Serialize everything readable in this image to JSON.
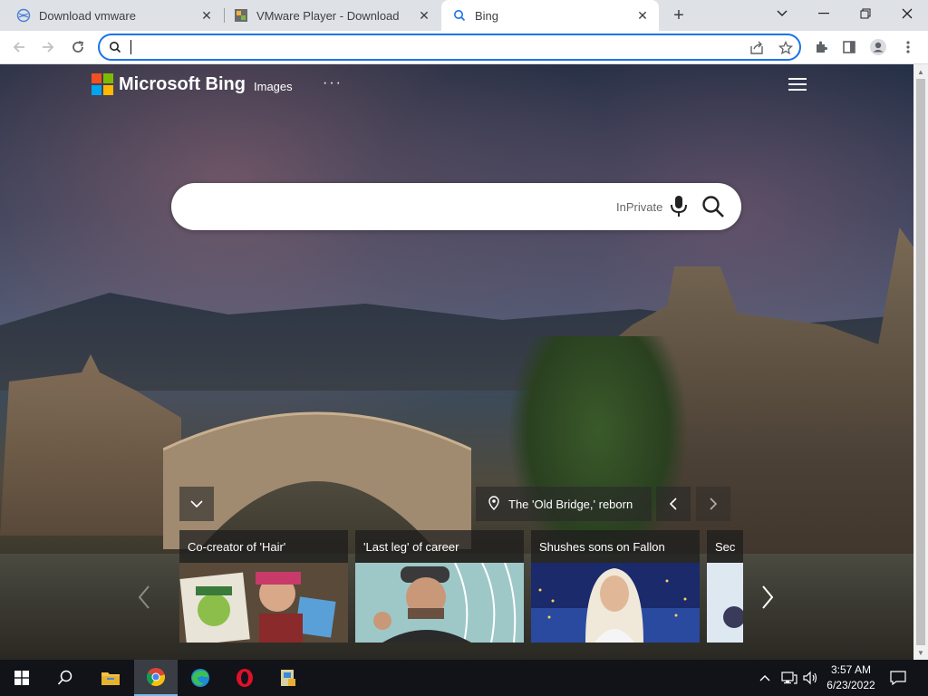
{
  "browser": {
    "tabs": [
      {
        "title": "Download vmware",
        "active": false
      },
      {
        "title": "VMware Player - Download",
        "active": false
      },
      {
        "title": "Bing",
        "active": true
      }
    ],
    "omnibox": {
      "value": "",
      "placeholder": ""
    }
  },
  "bing": {
    "logo_text": "Microsoft Bing",
    "nav_images": "Images",
    "nav_more": "···",
    "search": {
      "value": "",
      "inprivate_label": "InPrivate"
    },
    "image_info": "The 'Old Bridge,' reborn",
    "cards": [
      {
        "title": "Co-creator of 'Hair'"
      },
      {
        "title": "'Last leg' of career"
      },
      {
        "title": "Shushes sons on Fallon"
      },
      {
        "title": "Sec"
      }
    ]
  },
  "taskbar": {
    "time": "3:57 AM",
    "date": "6/23/2022"
  },
  "colors": {
    "ms_red": "#f25022",
    "ms_green": "#7fba00",
    "ms_blue": "#00a4ef",
    "ms_yellow": "#ffb900",
    "omnibox_focus": "#1a73e8"
  }
}
